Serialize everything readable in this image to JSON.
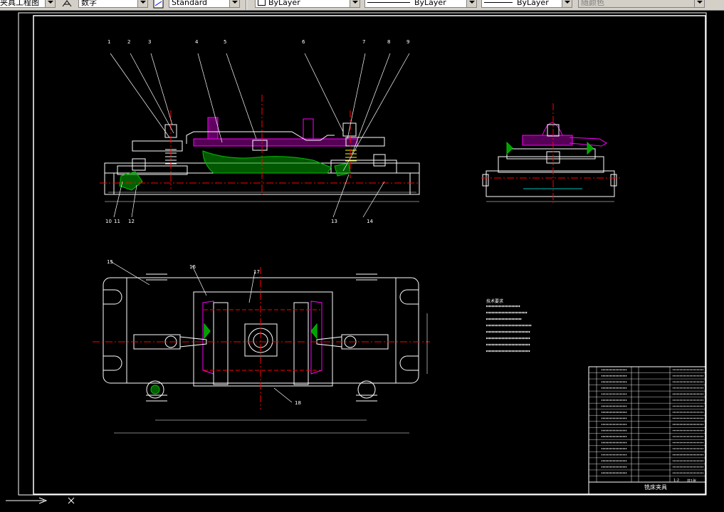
{
  "toolbar": {
    "layer_name": "夹具工程图",
    "text_style": "数字",
    "dim_style": "Standard",
    "layer_control": "ByLayer",
    "linetype": "ByLayer",
    "lineweight": "ByLayer",
    "plot_style": "随颜色"
  },
  "drawing": {
    "balloons_top": [
      "1",
      "2",
      "3",
      "4",
      "5",
      "6",
      "7",
      "8",
      "9"
    ],
    "balloons_bottom": [
      "10",
      "11",
      "12",
      "13",
      "14"
    ],
    "balloons_plan": [
      "15",
      "16",
      "17",
      "18"
    ],
    "notes_title": "技术要求"
  },
  "title_block": {
    "drawing_name": "铣床夹具",
    "scale": "1:2",
    "sheet": "共1张"
  },
  "colors": {
    "background": "#000000",
    "outline": "#ffffff",
    "centerline": "#ff0000",
    "hatch_green": "#00c000",
    "part_magenta": "#ff00ff",
    "dimension_cyan": "#00ffff",
    "yellow": "#ffff00"
  }
}
